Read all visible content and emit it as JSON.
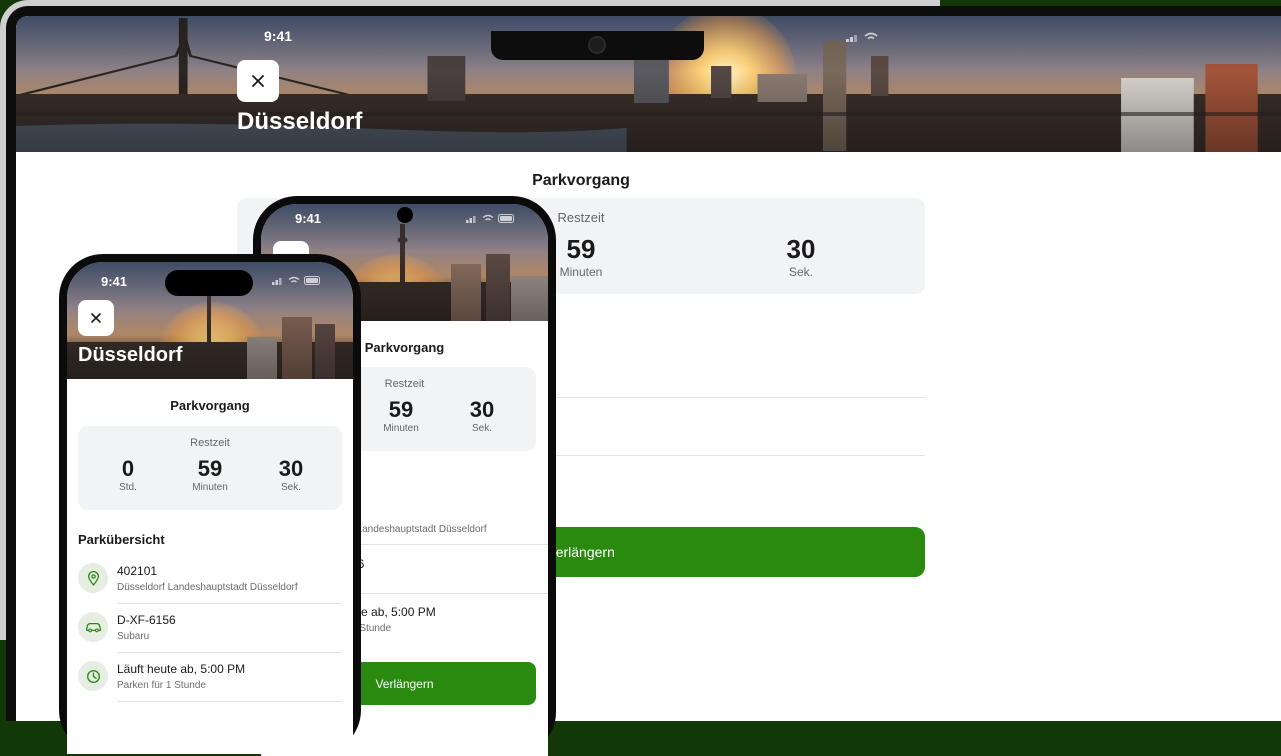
{
  "status": {
    "time": "9:41"
  },
  "city": "Düsseldorf",
  "session": {
    "title": "Parkvorgang",
    "remaining_label": "Restzeit",
    "hours": "0",
    "hours_label": "Std.",
    "minutes": "59",
    "minutes_label": "Minuten",
    "seconds": "30",
    "seconds_label": "Sek."
  },
  "overview": {
    "title": "Parkübersicht",
    "zone": {
      "title": "402101",
      "subtitle": "Düsseldorf Landeshauptstadt Düsseldorf"
    },
    "vehicle": {
      "title": "D-XF-6156",
      "subtitle": "Subaru"
    },
    "time": {
      "title": "Läuft heute ab, 5:00 PM",
      "subtitle": "Parken für 1 Stunde"
    }
  },
  "phone2_partial": {
    "city_fragment": "orf",
    "overview_fragment": "t",
    "zone_sub_fragment": "f Landeshauptstadt Düsseldorf",
    "vehicle_fragment": "56",
    "time_title_fragment": "ute ab, 5:00 PM",
    "time_sub_fragment": "1 Stunde"
  },
  "action": {
    "extend_label": "Verlängern"
  },
  "icons": {
    "close": "close-icon",
    "location": "location-pin-icon",
    "car": "car-icon",
    "clock": "clock-icon",
    "signal": "cellular-signal-icon",
    "wifi": "wifi-icon",
    "battery": "battery-icon"
  },
  "colors": {
    "background": "#123808",
    "accent": "#2a8a10",
    "icon_bg": "#e6ede2",
    "timer_bg": "#f2f3f5"
  }
}
